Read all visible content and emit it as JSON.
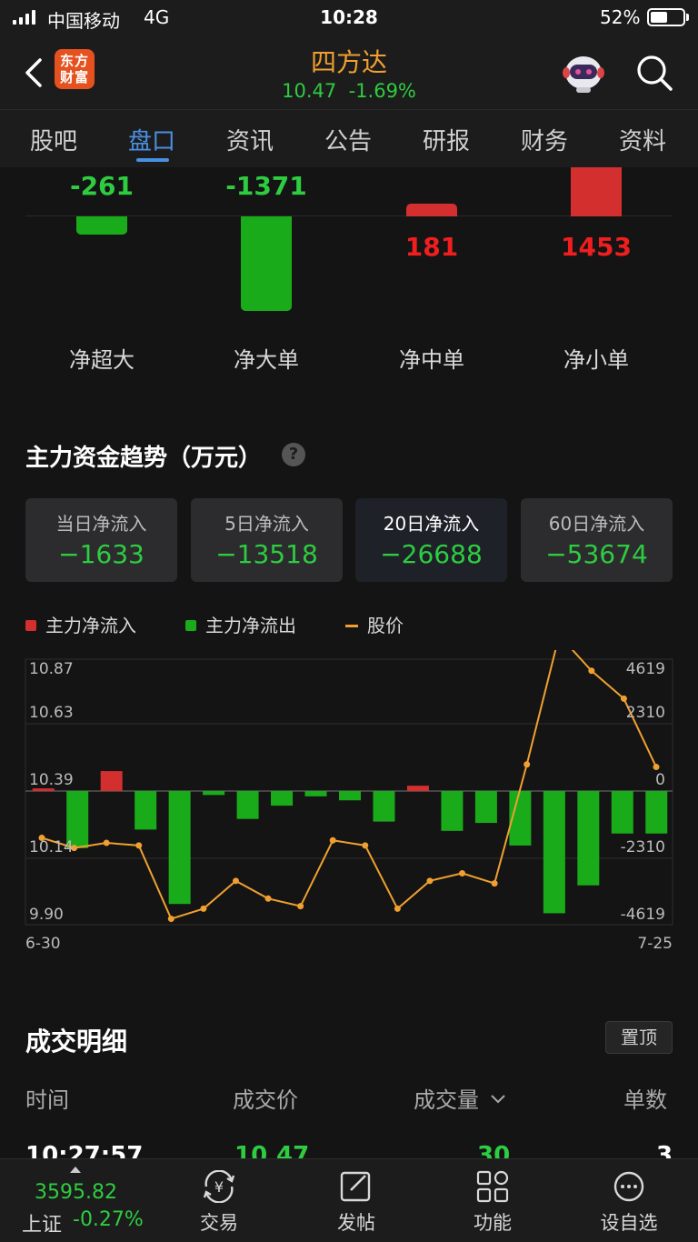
{
  "status_bar": {
    "carrier": "中国移动",
    "network": "4G",
    "time": "10:28",
    "battery": "52%",
    "battery_level": 0.52
  },
  "header": {
    "stock_name": "四方达",
    "price": "10.47",
    "change": "-1.69%",
    "logo_line1": "东方",
    "logo_line2": "财富"
  },
  "tabs": [
    {
      "label": "股吧"
    },
    {
      "label": "盘口"
    },
    {
      "label": "资讯"
    },
    {
      "label": "公告"
    },
    {
      "label": "研报"
    },
    {
      "label": "财务"
    },
    {
      "label": "资料"
    }
  ],
  "active_tab": "盘口",
  "net_flows": [
    {
      "label": "净超大",
      "value": "-261",
      "amount": -261
    },
    {
      "label": "净大单",
      "value": "-1371",
      "amount": -1371
    },
    {
      "label": "净中单",
      "value": "181",
      "amount": 181
    },
    {
      "label": "净小单",
      "value": "1453",
      "amount": 1453
    }
  ],
  "trend": {
    "title": "主力资金趋势（万元）",
    "help": "?",
    "cards": [
      {
        "title": "当日净流入",
        "value": "−1633"
      },
      {
        "title": "5日净流入",
        "value": "−13518"
      },
      {
        "title": "20日净流入",
        "value": "−26688"
      },
      {
        "title": "60日净流入",
        "value": "−53674"
      }
    ],
    "selected_card": "20日净流入",
    "legend": {
      "inflow": "主力净流入",
      "outflow": "主力净流出",
      "price": "股价"
    }
  },
  "chart_data": {
    "type": "bar",
    "x_start": "6-30",
    "x_end": "7-25",
    "left_axis_ticks": [
      "10.87",
      "10.63",
      "10.39",
      "10.14",
      "9.90"
    ],
    "right_axis_ticks": [
      "4619",
      "2310",
      "0",
      "-2310",
      "-4619"
    ],
    "ylim_price": [
      9.9,
      10.87
    ],
    "ylim_flow": [
      -4619,
      4619
    ],
    "series": [
      {
        "name": "主力净流入/主力净流出",
        "values": [
          100,
          -2150,
          750,
          -1450,
          -4250,
          -150,
          -1050,
          -550,
          -200,
          -350,
          -1150,
          200,
          -1500,
          -1200,
          -2050,
          -4600,
          -3550,
          -1600,
          -1600
        ]
      },
      {
        "name": "股价",
        "values": [
          10.2,
          10.16,
          10.18,
          10.17,
          9.88,
          9.92,
          10.03,
          9.96,
          9.93,
          10.19,
          10.17,
          9.92,
          10.03,
          10.06,
          10.02,
          10.49,
          11.0,
          10.86,
          10.75,
          10.48
        ]
      }
    ],
    "colors": {
      "inflow": "#d32f2f",
      "outflow": "#1aab1a",
      "price": "#f0a030"
    }
  },
  "trades": {
    "title": "成交明细",
    "pin_label": "置顶",
    "columns": {
      "time": "时间",
      "price": "成交价",
      "volume": "成交量",
      "count": "单数"
    },
    "first_row": {
      "time": "10:27:57",
      "price": "10.47",
      "volume": "30",
      "count": "3"
    }
  },
  "bottom_bar": {
    "index_value": "3595.82",
    "index_name": "上证",
    "index_change": "-0.27%",
    "nav": [
      {
        "label": "交易",
        "icon": "yen-exchange-icon"
      },
      {
        "label": "发帖",
        "icon": "compose-icon"
      },
      {
        "label": "功能",
        "icon": "grid-icon"
      },
      {
        "label": "设自选",
        "icon": "more-icon"
      }
    ]
  }
}
